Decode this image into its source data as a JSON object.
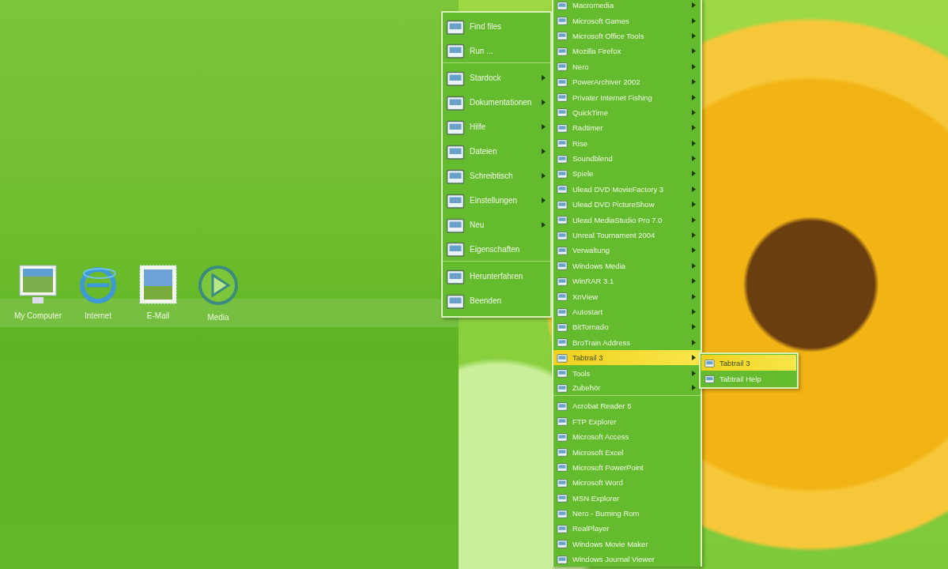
{
  "desktop_icons": [
    {
      "label": "My Computer",
      "kind": "computer"
    },
    {
      "label": "Internet",
      "kind": "globe"
    },
    {
      "label": "E-Mail",
      "kind": "stamp"
    },
    {
      "label": "Media",
      "kind": "play"
    }
  ],
  "start_menu": {
    "items": [
      {
        "label": "Find files",
        "submenu": false,
        "separator_after": false
      },
      {
        "label": "Run ...",
        "submenu": false,
        "separator_after": true
      },
      {
        "label": "Stardock",
        "submenu": true,
        "separator_after": false
      },
      {
        "label": "Dokumentationen",
        "submenu": true,
        "separator_after": false
      },
      {
        "label": "Hilfe",
        "submenu": true,
        "separator_after": false
      },
      {
        "label": "Dateien",
        "submenu": true,
        "separator_after": false
      },
      {
        "label": "Schreibtisch",
        "submenu": true,
        "separator_after": false
      },
      {
        "label": "Einstellungen",
        "submenu": true,
        "separator_after": false
      },
      {
        "label": "Neu",
        "submenu": true,
        "separator_after": false
      },
      {
        "label": "Eigenschaften",
        "submenu": false,
        "separator_after": true
      },
      {
        "label": "Herunterfahren",
        "submenu": false,
        "separator_after": false
      },
      {
        "label": "Beenden",
        "submenu": false,
        "separator_after": false
      }
    ]
  },
  "programs_menu": {
    "items": [
      {
        "label": "Macromedia",
        "submenu": true,
        "selected": false,
        "separator_after": false
      },
      {
        "label": "Microsoft Games",
        "submenu": true,
        "selected": false,
        "separator_after": false
      },
      {
        "label": "Microsoft Office Tools",
        "submenu": true,
        "selected": false,
        "separator_after": false
      },
      {
        "label": "Mozilla Firefox",
        "submenu": true,
        "selected": false,
        "separator_after": false
      },
      {
        "label": "Nero",
        "submenu": true,
        "selected": false,
        "separator_after": false
      },
      {
        "label": "PowerArchiver 2002",
        "submenu": true,
        "selected": false,
        "separator_after": false
      },
      {
        "label": "Privater Internet Fishing",
        "submenu": true,
        "selected": false,
        "separator_after": false
      },
      {
        "label": "QuickTime",
        "submenu": true,
        "selected": false,
        "separator_after": false
      },
      {
        "label": "Radtimer",
        "submenu": true,
        "selected": false,
        "separator_after": false
      },
      {
        "label": "Rise",
        "submenu": true,
        "selected": false,
        "separator_after": false
      },
      {
        "label": "Soundblend",
        "submenu": true,
        "selected": false,
        "separator_after": false
      },
      {
        "label": "Spiele",
        "submenu": true,
        "selected": false,
        "separator_after": false
      },
      {
        "label": "Ulead DVD MovieFactory 3",
        "submenu": true,
        "selected": false,
        "separator_after": false
      },
      {
        "label": "Ulead DVD PictureShow",
        "submenu": true,
        "selected": false,
        "separator_after": false
      },
      {
        "label": "Ulead MediaStudio Pro 7.0",
        "submenu": true,
        "selected": false,
        "separator_after": false
      },
      {
        "label": "Unreal Tournament 2004",
        "submenu": true,
        "selected": false,
        "separator_after": false
      },
      {
        "label": "Verwaltung",
        "submenu": true,
        "selected": false,
        "separator_after": false
      },
      {
        "label": "Windows Media",
        "submenu": true,
        "selected": false,
        "separator_after": false
      },
      {
        "label": "WinRAR 3.1",
        "submenu": true,
        "selected": false,
        "separator_after": false
      },
      {
        "label": "XnView",
        "submenu": true,
        "selected": false,
        "separator_after": false
      },
      {
        "label": "Autostart",
        "submenu": true,
        "selected": false,
        "separator_after": false
      },
      {
        "label": "BitTornado",
        "submenu": true,
        "selected": false,
        "separator_after": false
      },
      {
        "label": "BroTrain Address",
        "submenu": true,
        "selected": false,
        "separator_after": false
      },
      {
        "label": "Tabtrail 3",
        "submenu": true,
        "selected": true,
        "separator_after": false
      },
      {
        "label": "Tools",
        "submenu": true,
        "selected": false,
        "separator_after": false
      },
      {
        "label": "Zubehör",
        "submenu": true,
        "selected": false,
        "separator_after": true
      },
      {
        "label": "Acrobat Reader 5",
        "submenu": false,
        "selected": false,
        "separator_after": false
      },
      {
        "label": "FTP Explorer",
        "submenu": false,
        "selected": false,
        "separator_after": false
      },
      {
        "label": "Microsoft Access",
        "submenu": false,
        "selected": false,
        "separator_after": false
      },
      {
        "label": "Microsoft Excel",
        "submenu": false,
        "selected": false,
        "separator_after": false
      },
      {
        "label": "Microsoft PowerPoint",
        "submenu": false,
        "selected": false,
        "separator_after": false
      },
      {
        "label": "Microsoft Word",
        "submenu": false,
        "selected": false,
        "separator_after": false
      },
      {
        "label": "MSN Explorer",
        "submenu": false,
        "selected": false,
        "separator_after": false
      },
      {
        "label": "Nero - Burning Rom",
        "submenu": false,
        "selected": false,
        "separator_after": false
      },
      {
        "label": "RealPlayer",
        "submenu": false,
        "selected": false,
        "separator_after": false
      },
      {
        "label": "Windows Movie Maker",
        "submenu": false,
        "selected": false,
        "separator_after": false
      },
      {
        "label": "Windows Journal Viewer",
        "submenu": false,
        "selected": false,
        "separator_after": false
      }
    ]
  },
  "submenu": {
    "items": [
      {
        "label": "Tabtrail 3",
        "selected": true
      },
      {
        "label": "Tabtrail Help",
        "selected": false
      }
    ]
  }
}
